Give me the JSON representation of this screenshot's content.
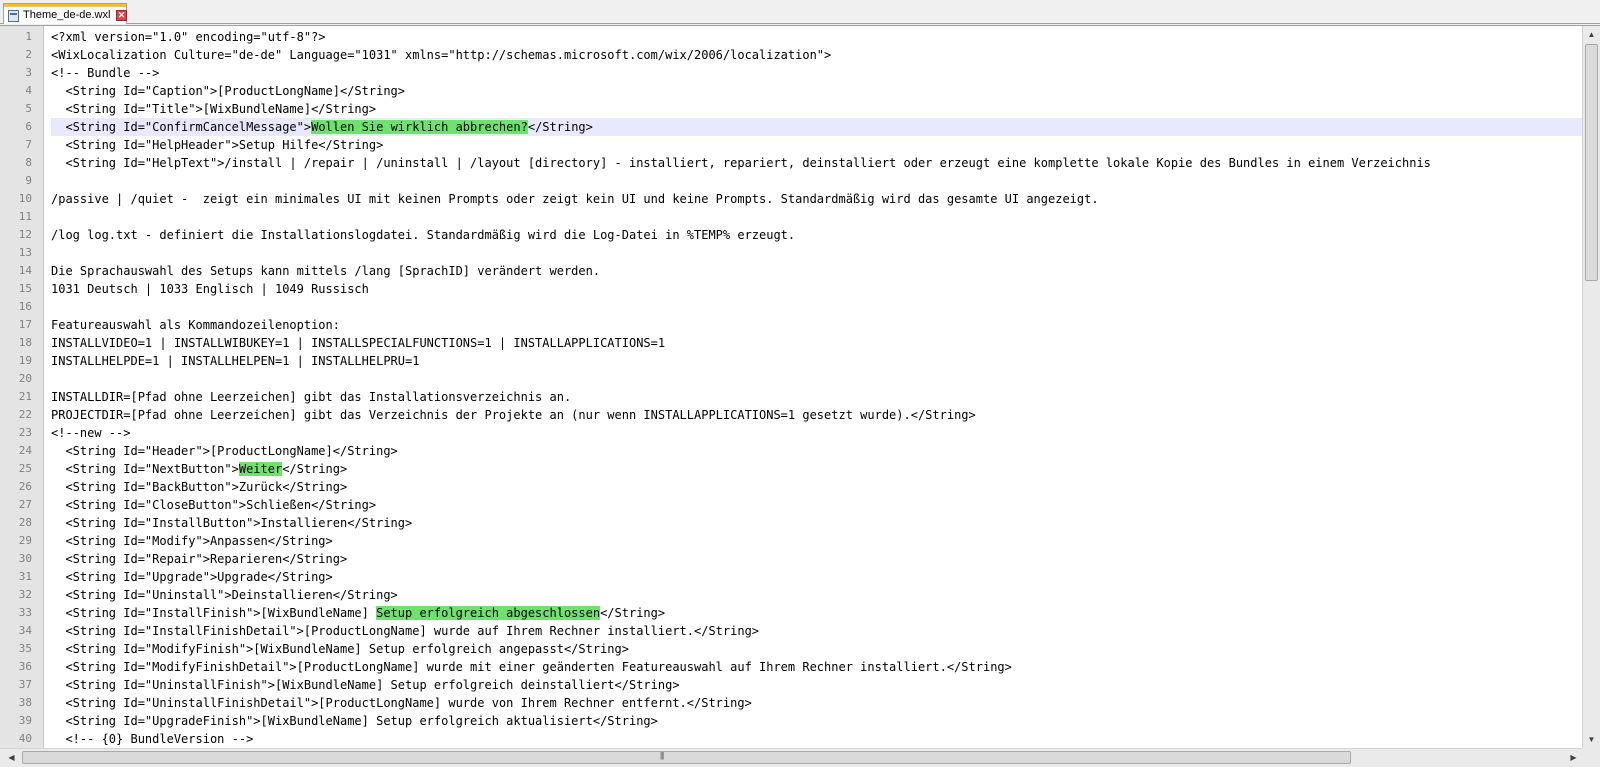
{
  "tab": {
    "title": "Theme_de-de.wxl",
    "close_glyph": "✕",
    "accent_color": "#fac11a"
  },
  "highlight_color": "#6de36d",
  "current_line": 6,
  "lines": [
    {
      "n": "1",
      "code": "<?xml version=\"1.0\" encoding=\"utf-8\"?>"
    },
    {
      "n": "2",
      "code": "<WixLocalization Culture=\"de-de\" Language=\"1031\" xmlns=\"http://schemas.microsoft.com/wix/2006/localization\">"
    },
    {
      "n": "3",
      "code": "<!-- Bundle -->"
    },
    {
      "n": "4",
      "code": "  <String Id=\"Caption\">[ProductLongName]</String>"
    },
    {
      "n": "5",
      "code": "  <String Id=\"Title\">[WixBundleName]</String>"
    },
    {
      "n": "6",
      "pre": "  <String Id=\"ConfirmCancelMessage\">",
      "hl": "Wollen Sie wirklich abbrechen?",
      "post": "</String>"
    },
    {
      "n": "7",
      "code": "  <String Id=\"HelpHeader\">Setup Hilfe</String>"
    },
    {
      "n": "8",
      "code": "  <String Id=\"HelpText\">/install | /repair | /uninstall | /layout [directory] - installiert, repariert, deinstalliert oder erzeugt eine komplette lokale Kopie des Bundles in einem Verzeichnis"
    },
    {
      "n": "9",
      "code": ""
    },
    {
      "n": "10",
      "code": "/passive | /quiet -  zeigt ein minimales UI mit keinen Prompts oder zeigt kein UI und keine Prompts. Standardmäßig wird das gesamte UI angezeigt."
    },
    {
      "n": "11",
      "code": ""
    },
    {
      "n": "12",
      "code": "/log log.txt - definiert die Installationslogdatei. Standardmäßig wird die Log-Datei in %TEMP% erzeugt."
    },
    {
      "n": "13",
      "code": ""
    },
    {
      "n": "14",
      "code": "Die Sprachauswahl des Setups kann mittels /lang [SprachID] verändert werden."
    },
    {
      "n": "15",
      "code": "1031 Deutsch | 1033 Englisch | 1049 Russisch"
    },
    {
      "n": "16",
      "code": ""
    },
    {
      "n": "17",
      "code": "Featureauswahl als Kommandozeilenoption:"
    },
    {
      "n": "18",
      "code": "INSTALLVIDEO=1 | INSTALLWIBUKEY=1 | INSTALLSPECIALFUNCTIONS=1 | INSTALLAPPLICATIONS=1"
    },
    {
      "n": "19",
      "code": "INSTALLHELPDE=1 | INSTALLHELPEN=1 | INSTALLHELPRU=1"
    },
    {
      "n": "20",
      "code": ""
    },
    {
      "n": "21",
      "code": "INSTALLDIR=[Pfad ohne Leerzeichen] gibt das Installationsverzeichnis an."
    },
    {
      "n": "22",
      "code": "PROJECTDIR=[Pfad ohne Leerzeichen] gibt das Verzeichnis der Projekte an (nur wenn INSTALLAPPLICATIONS=1 gesetzt wurde).</String>"
    },
    {
      "n": "23",
      "code": "<!--new -->"
    },
    {
      "n": "24",
      "code": "  <String Id=\"Header\">[ProductLongName]</String>"
    },
    {
      "n": "25",
      "pre": "  <String Id=\"NextButton\">",
      "hl": "Weiter",
      "post": "</String>"
    },
    {
      "n": "26",
      "code": "  <String Id=\"BackButton\">Zurück</String>"
    },
    {
      "n": "27",
      "code": "  <String Id=\"CloseButton\">Schließen</String>"
    },
    {
      "n": "28",
      "code": "  <String Id=\"InstallButton\">Installieren</String>"
    },
    {
      "n": "29",
      "code": "  <String Id=\"Modify\">Anpassen</String>"
    },
    {
      "n": "30",
      "code": "  <String Id=\"Repair\">Reparieren</String>"
    },
    {
      "n": "31",
      "code": "  <String Id=\"Upgrade\">Upgrade</String>"
    },
    {
      "n": "32",
      "code": "  <String Id=\"Uninstall\">Deinstallieren</String>"
    },
    {
      "n": "33",
      "pre": "  <String Id=\"InstallFinish\">[WixBundleName] ",
      "hl": "Setup erfolgreich abgeschlossen",
      "post": "</String>"
    },
    {
      "n": "34",
      "code": "  <String Id=\"InstallFinishDetail\">[ProductLongName] wurde auf Ihrem Rechner installiert.</String>"
    },
    {
      "n": "35",
      "code": "  <String Id=\"ModifyFinish\">[WixBundleName] Setup erfolgreich angepasst</String>"
    },
    {
      "n": "36",
      "code": "  <String Id=\"ModifyFinishDetail\">[ProductLongName] wurde mit einer geänderten Featureauswahl auf Ihrem Rechner installiert.</String>"
    },
    {
      "n": "37",
      "code": "  <String Id=\"UninstallFinish\">[WixBundleName] Setup erfolgreich deinstalliert</String>"
    },
    {
      "n": "38",
      "code": "  <String Id=\"UninstallFinishDetail\">[ProductLongName] wurde von Ihrem Rechner entfernt.</String>"
    },
    {
      "n": "39",
      "code": "  <String Id=\"UpgradeFinish\">[WixBundleName] Setup erfolgreich aktualisiert</String>"
    },
    {
      "n": "40",
      "code": "  <!-- {0} BundleVersion -->"
    }
  ]
}
